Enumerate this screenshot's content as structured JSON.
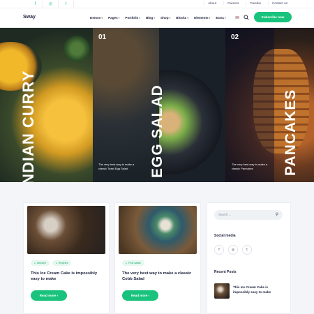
{
  "topbar": {
    "social_icons": [
      "facebook-icon",
      "instagram-icon",
      "twitter-icon"
    ],
    "social_glyphs": [
      "f",
      "◎",
      "t"
    ],
    "links": [
      "About",
      "Careers",
      "Freebie",
      "Contact us"
    ]
  },
  "nav": {
    "logo": "Sway",
    "menu": [
      "Demos",
      "Pages",
      "Portfolio",
      "Blog",
      "Shop",
      "Blocks",
      "Elements",
      "Extra"
    ],
    "subscribe_label": "Subscribe now"
  },
  "hero": {
    "panels": [
      {
        "number": "",
        "title": "INDIAN CURRY",
        "caption": ""
      },
      {
        "number": "01",
        "title": "EGG SALAD",
        "caption": "The very best way to make a classic Toast Egg Salad"
      },
      {
        "number": "02",
        "title": "PANCAKES",
        "caption": "The very best way to make a classic Pancakes"
      }
    ]
  },
  "cards": [
    {
      "tags": [
        "Dessert",
        "Recipes"
      ],
      "title": "This Ice Cream Cake is impossibly easy to make",
      "button": "Read more"
    },
    {
      "tags": [
        "Fruit salad"
      ],
      "title": "The very best way to make a classic Cobb Salad",
      "button": "Read more"
    }
  ],
  "sidebar": {
    "search_placeholder": "Search ...",
    "social_heading": "Social media",
    "social_glyphs": [
      "f",
      "◎",
      "t"
    ],
    "recent_heading": "Recent Posts",
    "recent_title": "This Ice Cream Cake is impossibly easy to make"
  },
  "colors": {
    "accent": "#19c37d",
    "dark": "#1b1f3b"
  }
}
